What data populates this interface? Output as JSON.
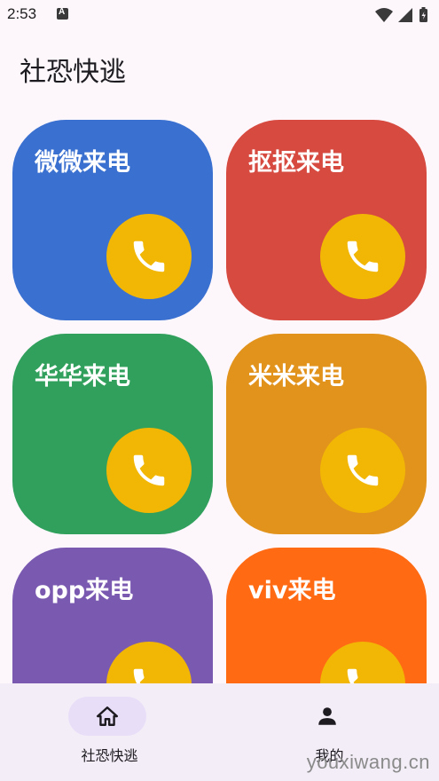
{
  "status": {
    "time": "2:53",
    "a_icon": "A"
  },
  "header": {
    "title": "社恐快逃"
  },
  "tiles": [
    {
      "label": "微微来电",
      "color": "#3a70d0"
    },
    {
      "label": "抠抠来电",
      "color": "#d64a40"
    },
    {
      "label": "华华来电",
      "color": "#31a05c"
    },
    {
      "label": "米米来电",
      "color": "#e2931c"
    },
    {
      "label": "opp来电",
      "color": "#7a59b0"
    },
    {
      "label": "viv来电",
      "color": "#ff6a13"
    }
  ],
  "call_button": {
    "icon": "phone-icon",
    "color": "#f2b705"
  },
  "bottom_nav": {
    "items": [
      {
        "label": "社恐快逃",
        "icon": "home-icon",
        "active": true
      },
      {
        "label": "我的",
        "icon": "person-icon",
        "active": false
      }
    ]
  },
  "watermark": "youxiwang.cn"
}
